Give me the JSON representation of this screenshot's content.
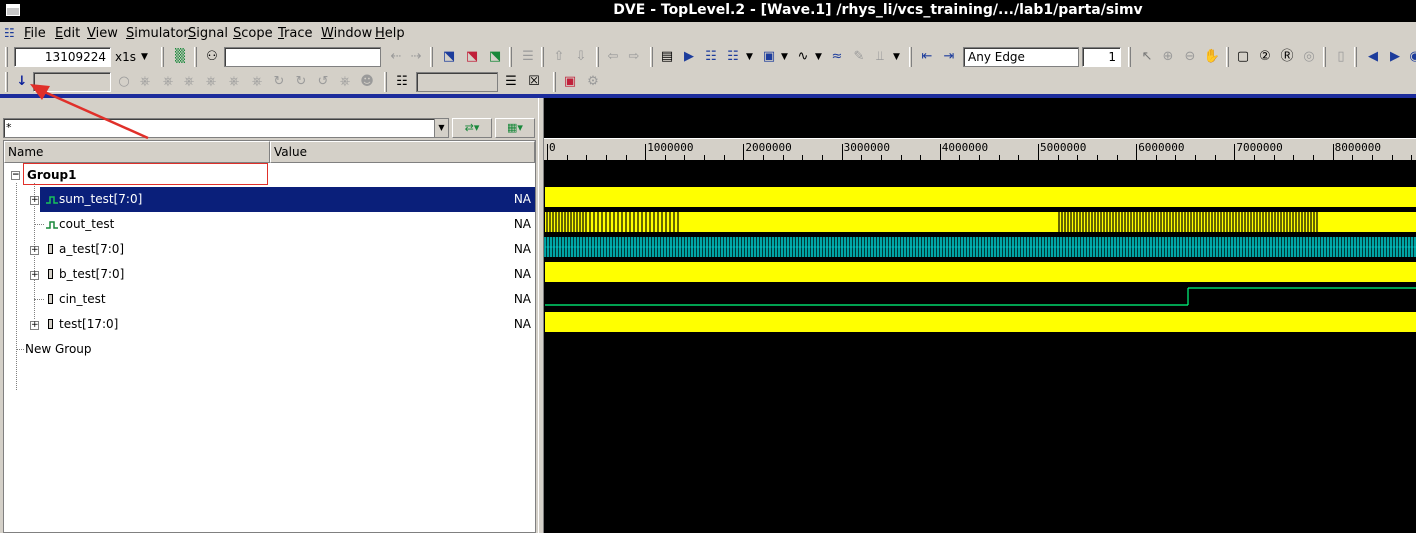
{
  "window": {
    "title": "DVE - TopLevel.2 - [Wave.1]  /rhys_li/vcs_training/.../lab1/parta/simv"
  },
  "menu": [
    "File",
    "Edit",
    "View",
    "Simulator",
    "Signal",
    "Scope",
    "Trace",
    "Window",
    "Help"
  ],
  "toolbar": {
    "time_value": "13109224",
    "time_unit": "x1s",
    "search_value": "",
    "edge_select": "Any Edge",
    "edge_count": "1"
  },
  "toolbar2": {
    "step_field": "",
    "scope_select": ""
  },
  "signal_panel": {
    "filter_value": "*",
    "columns": {
      "name": "Name",
      "value": "Value"
    },
    "groups": [
      {
        "name": "Group1",
        "signals": [
          {
            "name": "sum_test[7:0]",
            "value": "NA",
            "selected": true
          },
          {
            "name": "cout_test",
            "value": "NA"
          },
          {
            "name": "a_test[7:0]",
            "value": "NA"
          },
          {
            "name": "b_test[7:0]",
            "value": "NA"
          },
          {
            "name": "cin_test",
            "value": "NA"
          },
          {
            "name": "test[17:0]",
            "value": "NA"
          }
        ]
      },
      {
        "name": "New Group",
        "signals": []
      }
    ]
  },
  "wave_view": {
    "ruler_labels": [
      "0",
      "1000000",
      "2000000",
      "3000000",
      "4000000",
      "5000000",
      "6000000",
      "7000000",
      "8000000"
    ],
    "bus_color": "#ffff00",
    "scalar_color": "#00ff7f",
    "a_test_color": "#00e0e0",
    "background": "#000000"
  },
  "annotation": {
    "arrow_color": "#e0302a",
    "highlight_color": "#e0302a"
  }
}
